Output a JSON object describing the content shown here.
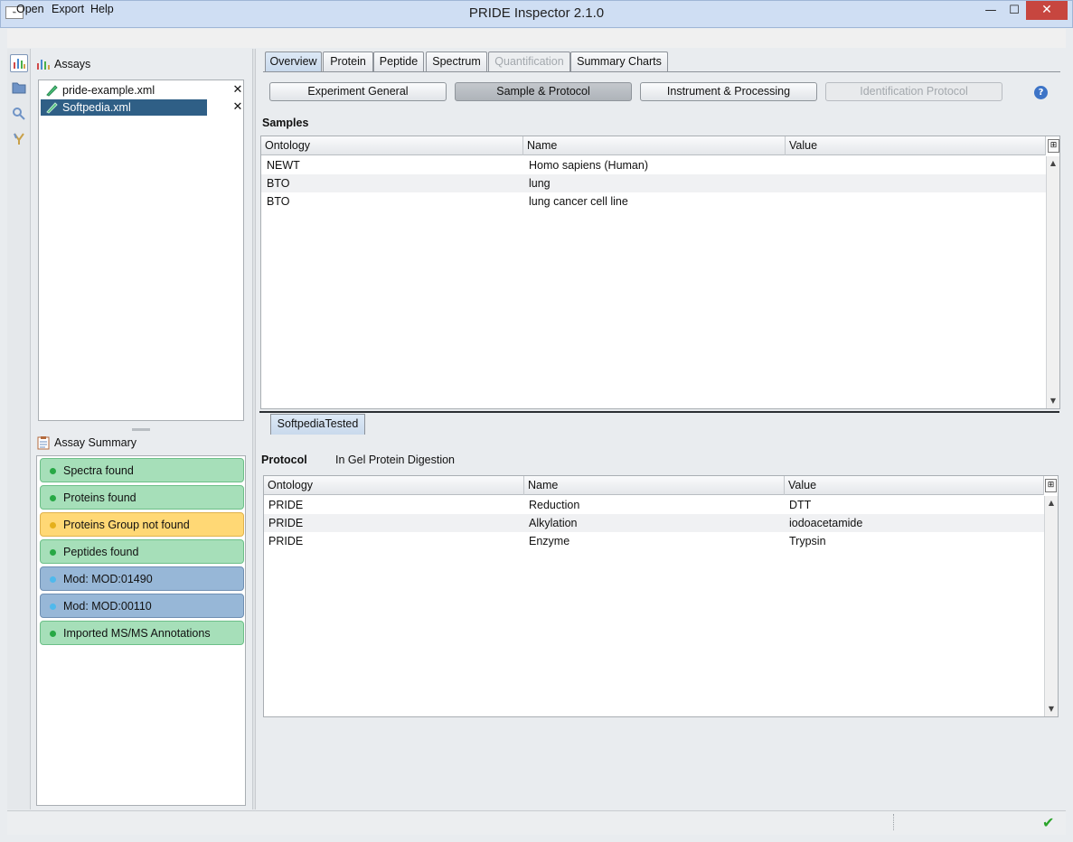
{
  "window": {
    "title": "PRIDE Inspector 2.1.0",
    "minimize": "—",
    "maximize": "☐",
    "close": "✕"
  },
  "menu": [
    "Open",
    "Export",
    "Help"
  ],
  "assays": {
    "title": "Assays",
    "files": [
      {
        "name": "pride-example.xml",
        "selected": false
      },
      {
        "name": "Softpedia.xml",
        "selected": true
      }
    ]
  },
  "summary": {
    "title": "Assay Summary",
    "items": [
      {
        "label": "Spectra found",
        "status": "green"
      },
      {
        "label": "Proteins found",
        "status": "green"
      },
      {
        "label": "Proteins Group not found",
        "status": "yellow"
      },
      {
        "label": "Peptides found",
        "status": "green"
      },
      {
        "label": "Mod: MOD:01490",
        "status": "blue"
      },
      {
        "label": "Mod: MOD:00110",
        "status": "blue"
      },
      {
        "label": "Imported MS/MS Annotations",
        "status": "green"
      }
    ]
  },
  "tabs": [
    {
      "label": "Overview",
      "state": "active"
    },
    {
      "label": "Protein",
      "state": "normal"
    },
    {
      "label": "Peptide",
      "state": "normal"
    },
    {
      "label": "Spectrum",
      "state": "normal"
    },
    {
      "label": "Quantification",
      "state": "disabled"
    },
    {
      "label": "Summary Charts",
      "state": "normal"
    }
  ],
  "panel_buttons": [
    {
      "label": "Experiment General",
      "state": "normal"
    },
    {
      "label": "Sample & Protocol",
      "state": "active"
    },
    {
      "label": "Instrument & Processing",
      "state": "normal"
    },
    {
      "label": "Identification Protocol",
      "state": "disabled"
    }
  ],
  "samples": {
    "title": "Samples",
    "columns": [
      "Ontology",
      "Name",
      "Value"
    ],
    "rows": [
      [
        "NEWT",
        "Homo sapiens (Human)",
        ""
      ],
      [
        "BTO",
        "lung",
        ""
      ],
      [
        "BTO",
        "lung cancer cell line",
        ""
      ]
    ]
  },
  "sample_tab": "SoftpediaTested",
  "protocol": {
    "label": "Protocol",
    "name": "In Gel Protein Digestion",
    "columns": [
      "Ontology",
      "Name",
      "Value"
    ],
    "rows": [
      [
        "PRIDE",
        "Reduction",
        "DTT"
      ],
      [
        "PRIDE",
        "Alkylation",
        "iodoacetamide"
      ],
      [
        "PRIDE",
        "Enzyme",
        "Trypsin"
      ]
    ]
  },
  "colors": {
    "selection": "#2f5f86",
    "close_button": "#c7463f",
    "ok_status": "#2ba42b"
  }
}
